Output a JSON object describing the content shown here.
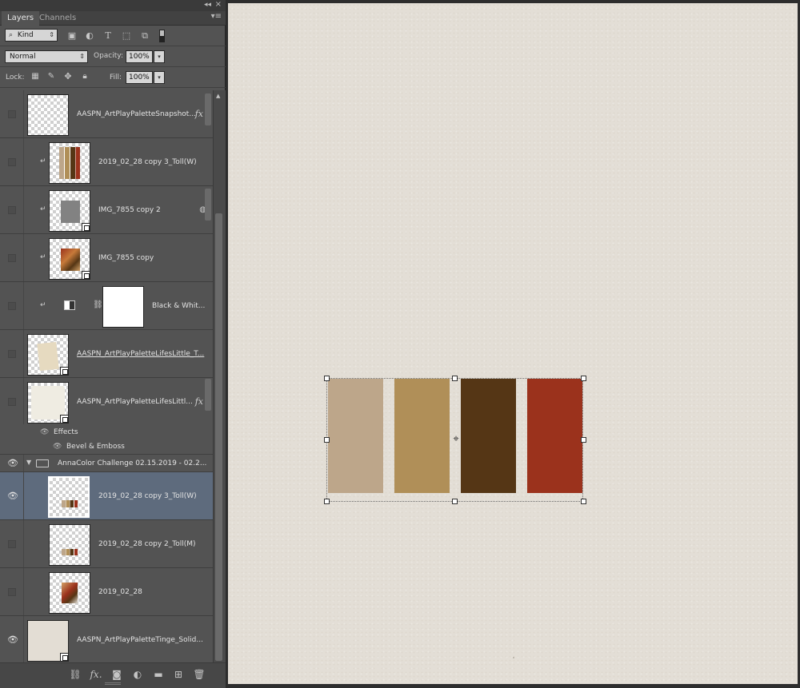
{
  "panel": {
    "tabs": [
      "Layers",
      "Channels"
    ],
    "collapse_icon": "double-arrow-left",
    "close_icon": "close",
    "menu_icon": "panel-menu",
    "filter": {
      "kind_label": "Kind"
    },
    "blend_mode": "Normal",
    "opacity_label": "Opacity:",
    "opacity_value": "100%",
    "lock_label": "Lock:",
    "fill_label": "Fill:",
    "fill_value": "100%"
  },
  "layers": [
    {
      "name": "AASPN_ArtPlayPaletteSnapshot...",
      "visible": false,
      "fx": "fx"
    },
    {
      "name": "2019_02_28 copy 3_Toll(W)",
      "visible": false
    },
    {
      "name": "IMG_7855 copy 2",
      "visible": false
    },
    {
      "name": "IMG_7855 copy",
      "visible": false
    },
    {
      "name": "Black & Whit...",
      "visible": false
    },
    {
      "name": "AASPN_ArtPlayPaletteLifesLittle_T...",
      "visible": false
    },
    {
      "name": "AASPN_ArtPlayPaletteLifesLittl...",
      "visible": false,
      "fx": "fx"
    },
    {
      "name": "Effects"
    },
    {
      "name": "Bevel & Emboss"
    },
    {
      "name": "AnnaColor Challenge 02.15.2019 - 02.2...",
      "visible": true
    },
    {
      "name": "2019_02_28 copy 3_Toll(W)",
      "visible": true,
      "selected": true
    },
    {
      "name": "2019_02_28 copy 2_Toll(M)",
      "visible": false
    },
    {
      "name": "2019_02_28",
      "visible": false
    },
    {
      "name": "AASPN_ArtPlayPaletteTinge_Solid...",
      "visible": true
    }
  ],
  "canvas": {
    "background": "#e3ded6",
    "swatches": [
      "#bda68a",
      "#b08f58",
      "#553615",
      "#9b321c"
    ]
  }
}
